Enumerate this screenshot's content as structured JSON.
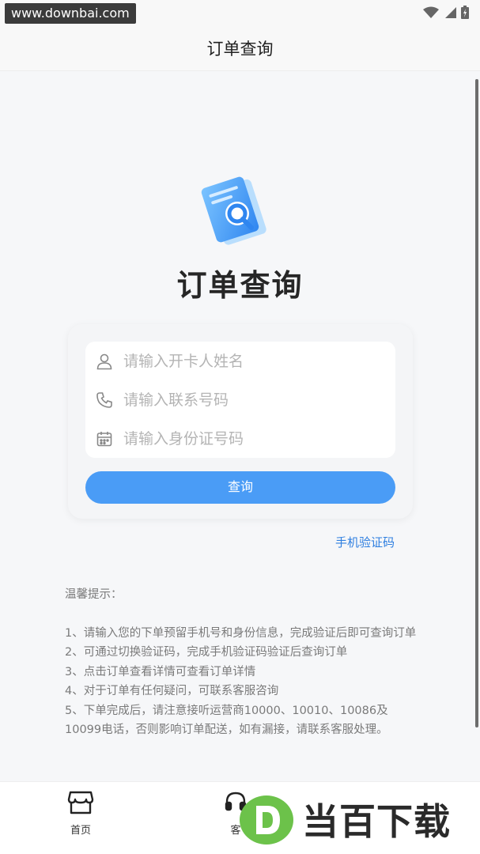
{
  "status_bar": {
    "watermark_url": "www.downbai.com",
    "icons": [
      "wifi-icon",
      "signal-icon",
      "battery-icon"
    ]
  },
  "header": {
    "title": "订单查询"
  },
  "hero": {
    "title": "订单查询",
    "icon": "order-search-icon"
  },
  "form": {
    "name_placeholder": "请输入开卡人姓名",
    "phone_placeholder": "请输入联系号码",
    "id_placeholder": "请输入身份证号码",
    "submit_label": "查询",
    "sms_link": "手机验证码"
  },
  "tips": {
    "title": "温馨提示：",
    "items": [
      "1、请输入您的下单预留手机号和身份信息，完成验证后即可查询订单",
      "2、可通过切换验证码，完成手机验证码验证后查询订单",
      "3、点击订单查看详情可查看订单详情",
      "4、对于订单有任何疑问，可联系客服咨询",
      "5、下单完成后，请注意接听运营商10000、10010、10086及10099电话，否则影响订单配送，如有漏接，请联系客服处理。"
    ]
  },
  "bottom_nav": {
    "items": [
      {
        "label": "首页",
        "icon": "store-icon"
      },
      {
        "label": "客",
        "icon": "headset-icon"
      }
    ]
  },
  "watermark_logo": {
    "text": "当百下载",
    "letter": "D"
  },
  "colors": {
    "accent": "#4a9cf6",
    "link": "#2f7fe0",
    "logo_green": "#6cc24a",
    "background": "#f6f7f9"
  }
}
